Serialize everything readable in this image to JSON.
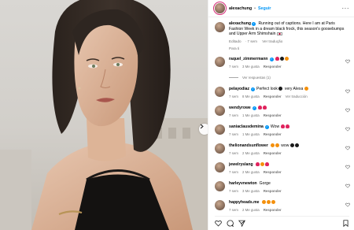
{
  "post": {
    "username": "alexachung",
    "follow_label": "Seguir",
    "caption": "Running out of captions. Here I am at Paris Fashion Week in a dream black frock, this season's goosebumps and Upper Arm Shimshain",
    "caption_edited": "Editado",
    "caption_time": "7 sem",
    "caption_translate": "Ver tradução",
    "translate_label": "Para ti",
    "colors": {
      "accent": "#0095f6",
      "story_ring": "#d62976",
      "heart_red": "#e0245e"
    }
  },
  "comments": [
    {
      "user": "raquel_zimmermann",
      "verified": true,
      "text": "",
      "emojis": [
        "red",
        "blk",
        "org"
      ],
      "time": "7 sem",
      "likes": "3 Me gusta",
      "reply": "Responder",
      "view_replies": "Ver respuestas (1)"
    },
    {
      "user": "pelayodiaz",
      "verified": true,
      "text": "Perfect look",
      "text_after": "very Alexa",
      "emojis": [
        "blk"
      ],
      "emojis_after": [
        "org"
      ],
      "time": "7 sem",
      "likes": "8 Me gusta",
      "reply": "Responder",
      "translate": "Ver traducción"
    },
    {
      "user": "wendyrowe",
      "verified": true,
      "text": "",
      "emojis": [
        "red",
        "red"
      ],
      "time": "7 sem",
      "likes": "1 Me gusta",
      "reply": "Responder"
    },
    {
      "user": "saniaclausdemina",
      "verified": true,
      "text": "Wow",
      "emojis": [
        "red",
        "red"
      ],
      "time": "7 sem",
      "likes": "1 Me gusta",
      "reply": "Responder"
    },
    {
      "user": "thelionandsunflower",
      "verified": false,
      "text": "",
      "emojis": [
        "org",
        "org"
      ],
      "text_after": "wow",
      "emojis_after": [
        "blk",
        "blk"
      ],
      "time": "7 sem",
      "likes": "2 Me gusta",
      "reply": "Responder"
    },
    {
      "user": "jewelryslang",
      "verified": false,
      "text": "",
      "emojis": [
        "red",
        "org",
        "red"
      ],
      "time": "7 sem",
      "likes": "2 Me gusta",
      "reply": "Responder"
    },
    {
      "user": "harleyvnewton",
      "verified": false,
      "text": "Gorge",
      "emojis": [],
      "time": "7 sem",
      "likes": "3 Me gusta",
      "reply": "Responder"
    },
    {
      "user": "happyheads.me",
      "verified": false,
      "text": "",
      "emojis": [
        "org",
        "org",
        "org"
      ],
      "time": "7 sem",
      "likes": "2 Me gusta",
      "reply": "Responder"
    }
  ]
}
